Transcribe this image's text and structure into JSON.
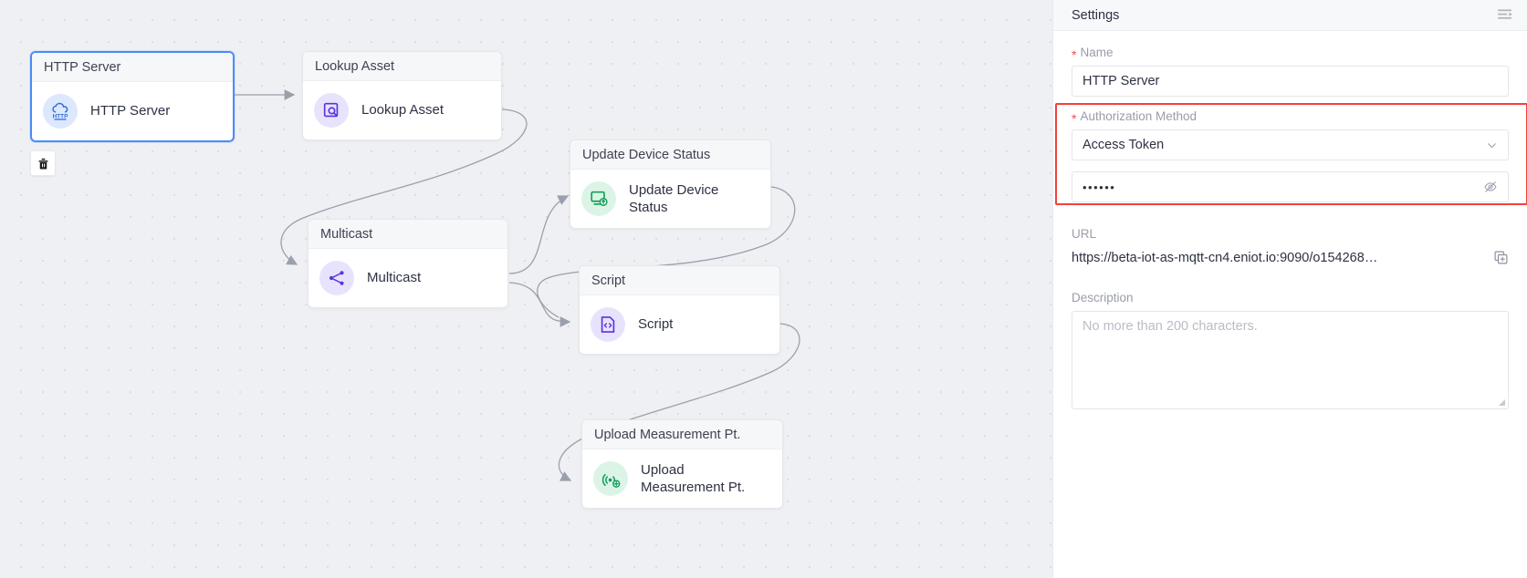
{
  "canvas": {
    "nodes": [
      {
        "id": "http-server",
        "header": "HTTP Server",
        "label": "HTTP Server",
        "icon": "http-cloud-icon",
        "icon_style": "blue",
        "selected": true
      },
      {
        "id": "lookup-asset",
        "header": "Lookup Asset",
        "label": "Lookup Asset",
        "icon": "lookup-asset-icon",
        "icon_style": "purple",
        "selected": false
      },
      {
        "id": "multicast",
        "header": "Multicast",
        "label": "Multicast",
        "icon": "multicast-share-icon",
        "icon_style": "purple",
        "selected": false
      },
      {
        "id": "update-device",
        "header": "Update Device Status",
        "label": "Update Device Status",
        "icon": "update-device-icon",
        "icon_style": "green",
        "selected": false
      },
      {
        "id": "script",
        "header": "Script",
        "label": "Script",
        "icon": "script-code-icon",
        "icon_style": "purple",
        "selected": false
      },
      {
        "id": "upload-meas",
        "header": "Upload Measurement Pt.",
        "label": "Upload Measurement Pt.",
        "icon": "upload-signal-icon",
        "icon_style": "green",
        "selected": false
      }
    ],
    "delete_button": {
      "tooltip": "Delete",
      "icon": "trash-icon"
    }
  },
  "panel": {
    "title": "Settings",
    "collapse_icon": "panel-collapse-icon",
    "name": {
      "label": "Name",
      "required": true,
      "value": "HTTP Server"
    },
    "authorization": {
      "label": "Authorization Method",
      "required": true,
      "selected": "Access Token",
      "dropdown_icon": "chevron-down-icon",
      "token_value": "••••••",
      "token_visibility_icon": "eye-slash-icon",
      "highlight_color": "#f4403a"
    },
    "url": {
      "label": "URL",
      "value": "https://beta-iot-as-mqtt-cn4.eniot.io:9090/o154268…",
      "copy_icon": "copy-icon"
    },
    "description": {
      "label": "Description",
      "placeholder": "No more than 200 characters."
    }
  },
  "colors": {
    "canvas_bg": "#eff0f3",
    "node_border": "#e6e7eb",
    "selected_border": "#4a8cf7",
    "accent_red": "#f4403a",
    "purple": "#5b33e0",
    "green": "#10a05c",
    "edge": "#9aa0ac"
  }
}
